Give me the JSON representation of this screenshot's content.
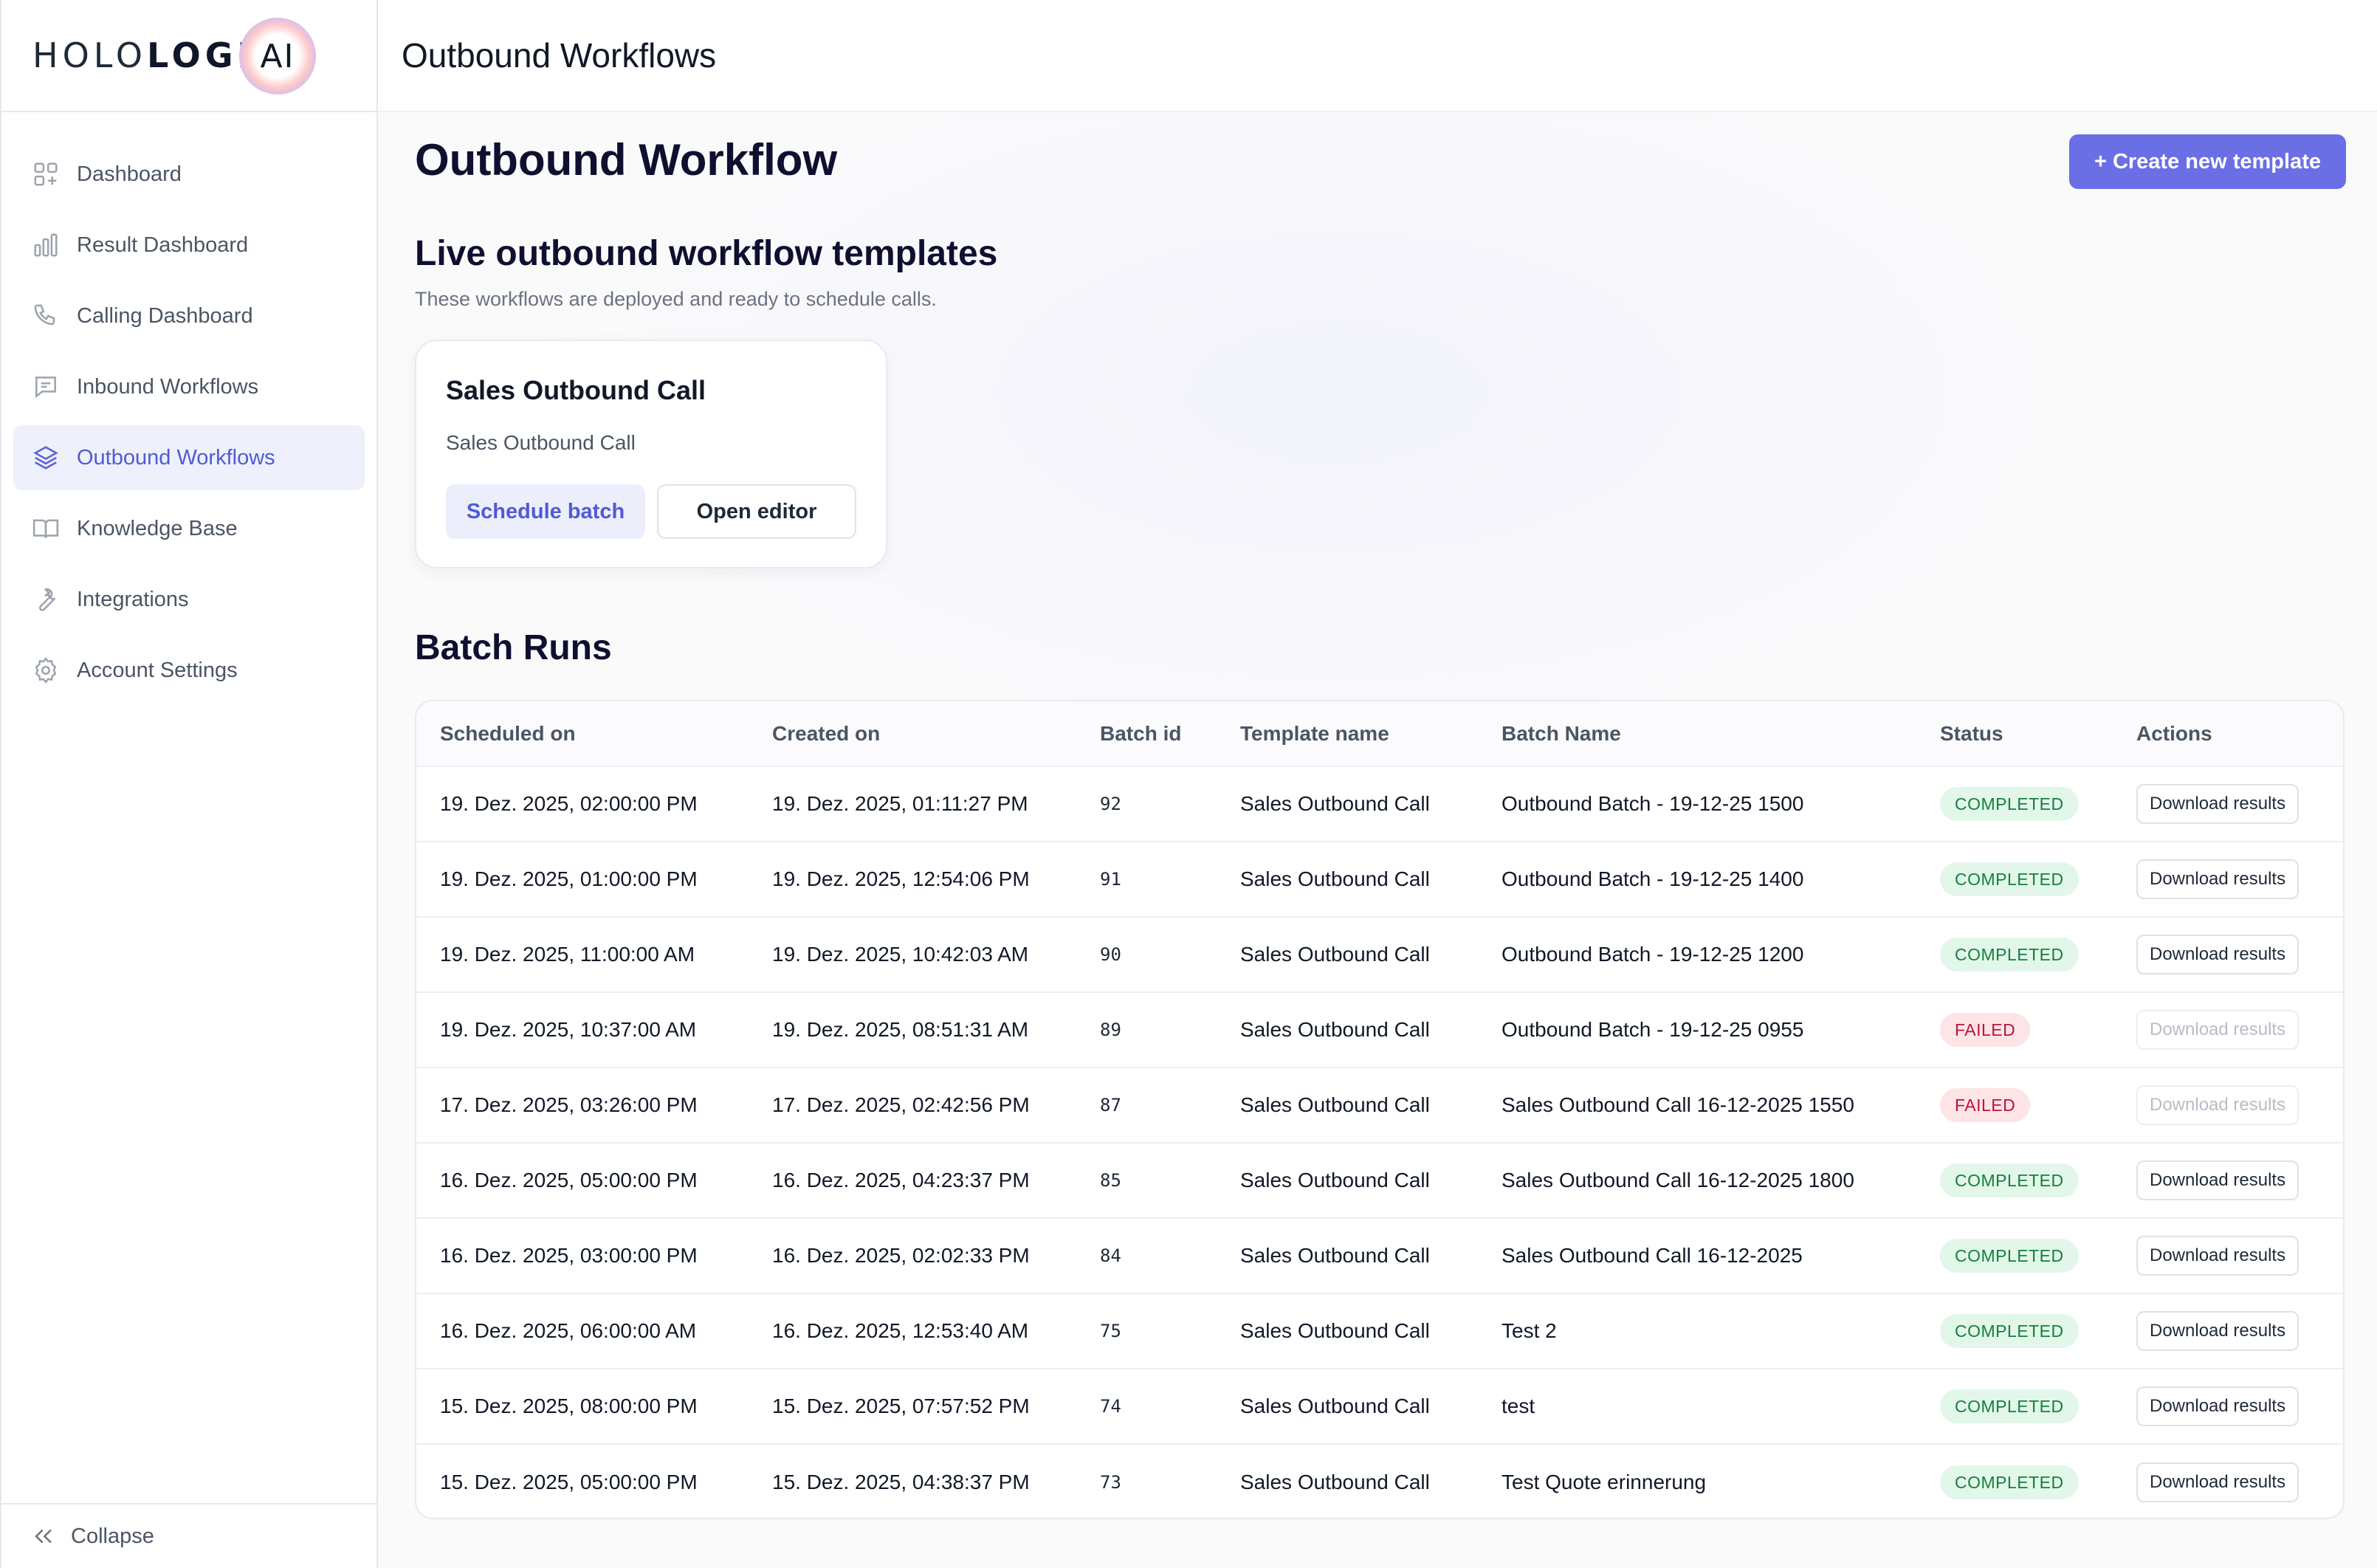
{
  "brand": {
    "logo_left": "HOLO",
    "logo_mid": "LOGIX",
    "logo_right": "AI"
  },
  "topbar": {
    "title": "Outbound Workflows"
  },
  "sidebar": {
    "items": [
      {
        "label": "Dashboard",
        "icon": "dashboard-icon",
        "active": false
      },
      {
        "label": "Result Dashboard",
        "icon": "bar-chart-icon",
        "active": false
      },
      {
        "label": "Calling Dashboard",
        "icon": "phone-icon",
        "active": false
      },
      {
        "label": "Inbound Workflows",
        "icon": "message-icon",
        "active": false
      },
      {
        "label": "Outbound Workflows",
        "icon": "layers-icon",
        "active": true
      },
      {
        "label": "Knowledge Base",
        "icon": "book-icon",
        "active": false
      },
      {
        "label": "Integrations",
        "icon": "wrench-icon",
        "active": false
      },
      {
        "label": "Account Settings",
        "icon": "gear-icon",
        "active": false
      }
    ],
    "collapse_label": "Collapse"
  },
  "page": {
    "title": "Outbound Workflow",
    "create_button": "+ Create new template",
    "live_section_title": "Live outbound workflow templates",
    "live_section_subtitle": "These workflows are deployed and ready to schedule calls.",
    "template_card": {
      "title": "Sales Outbound Call",
      "description": "Sales Outbound Call",
      "schedule_button": "Schedule batch",
      "editor_button": "Open editor"
    },
    "batch_section_title": "Batch Runs"
  },
  "table": {
    "columns": [
      "Scheduled on",
      "Created on",
      "Batch id",
      "Template name",
      "Batch Name",
      "Status",
      "Actions"
    ],
    "rows": [
      {
        "scheduled": "19. Dez. 2025, 02:00:00 PM",
        "created": "19. Dez. 2025, 01:11:27 PM",
        "id": "92",
        "template": "Sales Outbound Call",
        "batch": "Outbound Batch - 19-12-25 1500",
        "status": "COMPLETED",
        "action": "Download results",
        "action_enabled": true
      },
      {
        "scheduled": "19. Dez. 2025, 01:00:00 PM",
        "created": "19. Dez. 2025, 12:54:06 PM",
        "id": "91",
        "template": "Sales Outbound Call",
        "batch": "Outbound Batch - 19-12-25 1400",
        "status": "COMPLETED",
        "action": "Download results",
        "action_enabled": true
      },
      {
        "scheduled": "19. Dez. 2025, 11:00:00 AM",
        "created": "19. Dez. 2025, 10:42:03 AM",
        "id": "90",
        "template": "Sales Outbound Call",
        "batch": "Outbound Batch - 19-12-25 1200",
        "status": "COMPLETED",
        "action": "Download results",
        "action_enabled": true
      },
      {
        "scheduled": "19. Dez. 2025, 10:37:00 AM",
        "created": "19. Dez. 2025, 08:51:31 AM",
        "id": "89",
        "template": "Sales Outbound Call",
        "batch": "Outbound Batch - 19-12-25 0955",
        "status": "FAILED",
        "action": "Download results",
        "action_enabled": false
      },
      {
        "scheduled": "17. Dez. 2025, 03:26:00 PM",
        "created": "17. Dez. 2025, 02:42:56 PM",
        "id": "87",
        "template": "Sales Outbound Call",
        "batch": "Sales Outbound Call 16-12-2025 1550",
        "status": "FAILED",
        "action": "Download results",
        "action_enabled": false
      },
      {
        "scheduled": "16. Dez. 2025, 05:00:00 PM",
        "created": "16. Dez. 2025, 04:23:37 PM",
        "id": "85",
        "template": "Sales Outbound Call",
        "batch": "Sales Outbound Call 16-12-2025 1800",
        "status": "COMPLETED",
        "action": "Download results",
        "action_enabled": true
      },
      {
        "scheduled": "16. Dez. 2025, 03:00:00 PM",
        "created": "16. Dez. 2025, 02:02:33 PM",
        "id": "84",
        "template": "Sales Outbound Call",
        "batch": "Sales Outbound Call 16-12-2025",
        "status": "COMPLETED",
        "action": "Download results",
        "action_enabled": true
      },
      {
        "scheduled": "16. Dez. 2025, 06:00:00 AM",
        "created": "16. Dez. 2025, 12:53:40 AM",
        "id": "75",
        "template": "Sales Outbound Call",
        "batch": "Test 2",
        "status": "COMPLETED",
        "action": "Download results",
        "action_enabled": true
      },
      {
        "scheduled": "15. Dez. 2025, 08:00:00 PM",
        "created": "15. Dez. 2025, 07:57:52 PM",
        "id": "74",
        "template": "Sales Outbound Call",
        "batch": "test",
        "status": "COMPLETED",
        "action": "Download results",
        "action_enabled": true
      },
      {
        "scheduled": "15. Dez. 2025, 05:00:00 PM",
        "created": "15. Dez. 2025, 04:38:37 PM",
        "id": "73",
        "template": "Sales Outbound Call",
        "batch": "Test Quote erinnerung",
        "status": "COMPLETED",
        "action": "Download results",
        "action_enabled": true
      }
    ]
  },
  "colors": {
    "accent": "#6a6fe6",
    "active_nav_bg": "#eef0fb",
    "active_nav_text": "#4f5bd5",
    "status_completed_bg": "#e2f7ea",
    "status_completed_text": "#15803d",
    "status_failed_bg": "#fde4e6",
    "status_failed_text": "#be123c"
  }
}
